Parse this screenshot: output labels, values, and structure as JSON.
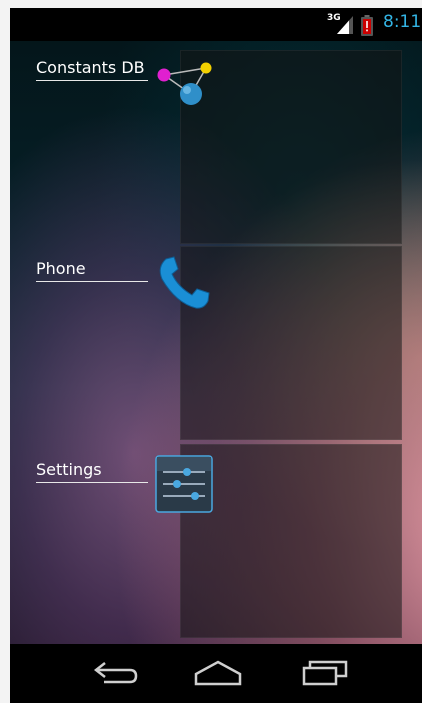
{
  "status_bar": {
    "network": "3G",
    "time": "8:11",
    "icons": [
      "signal-icon",
      "battery-icon"
    ],
    "time_color": "#33b5e5"
  },
  "widgets": [
    {
      "label": "Constants DB",
      "icon": "molecule-icon"
    },
    {
      "label": "Phone",
      "icon": "phone-icon"
    },
    {
      "label": "Settings",
      "icon": "settings-sliders-icon"
    }
  ],
  "nav_bar": {
    "buttons": [
      "back-icon",
      "home-icon",
      "recent-apps-icon"
    ]
  }
}
